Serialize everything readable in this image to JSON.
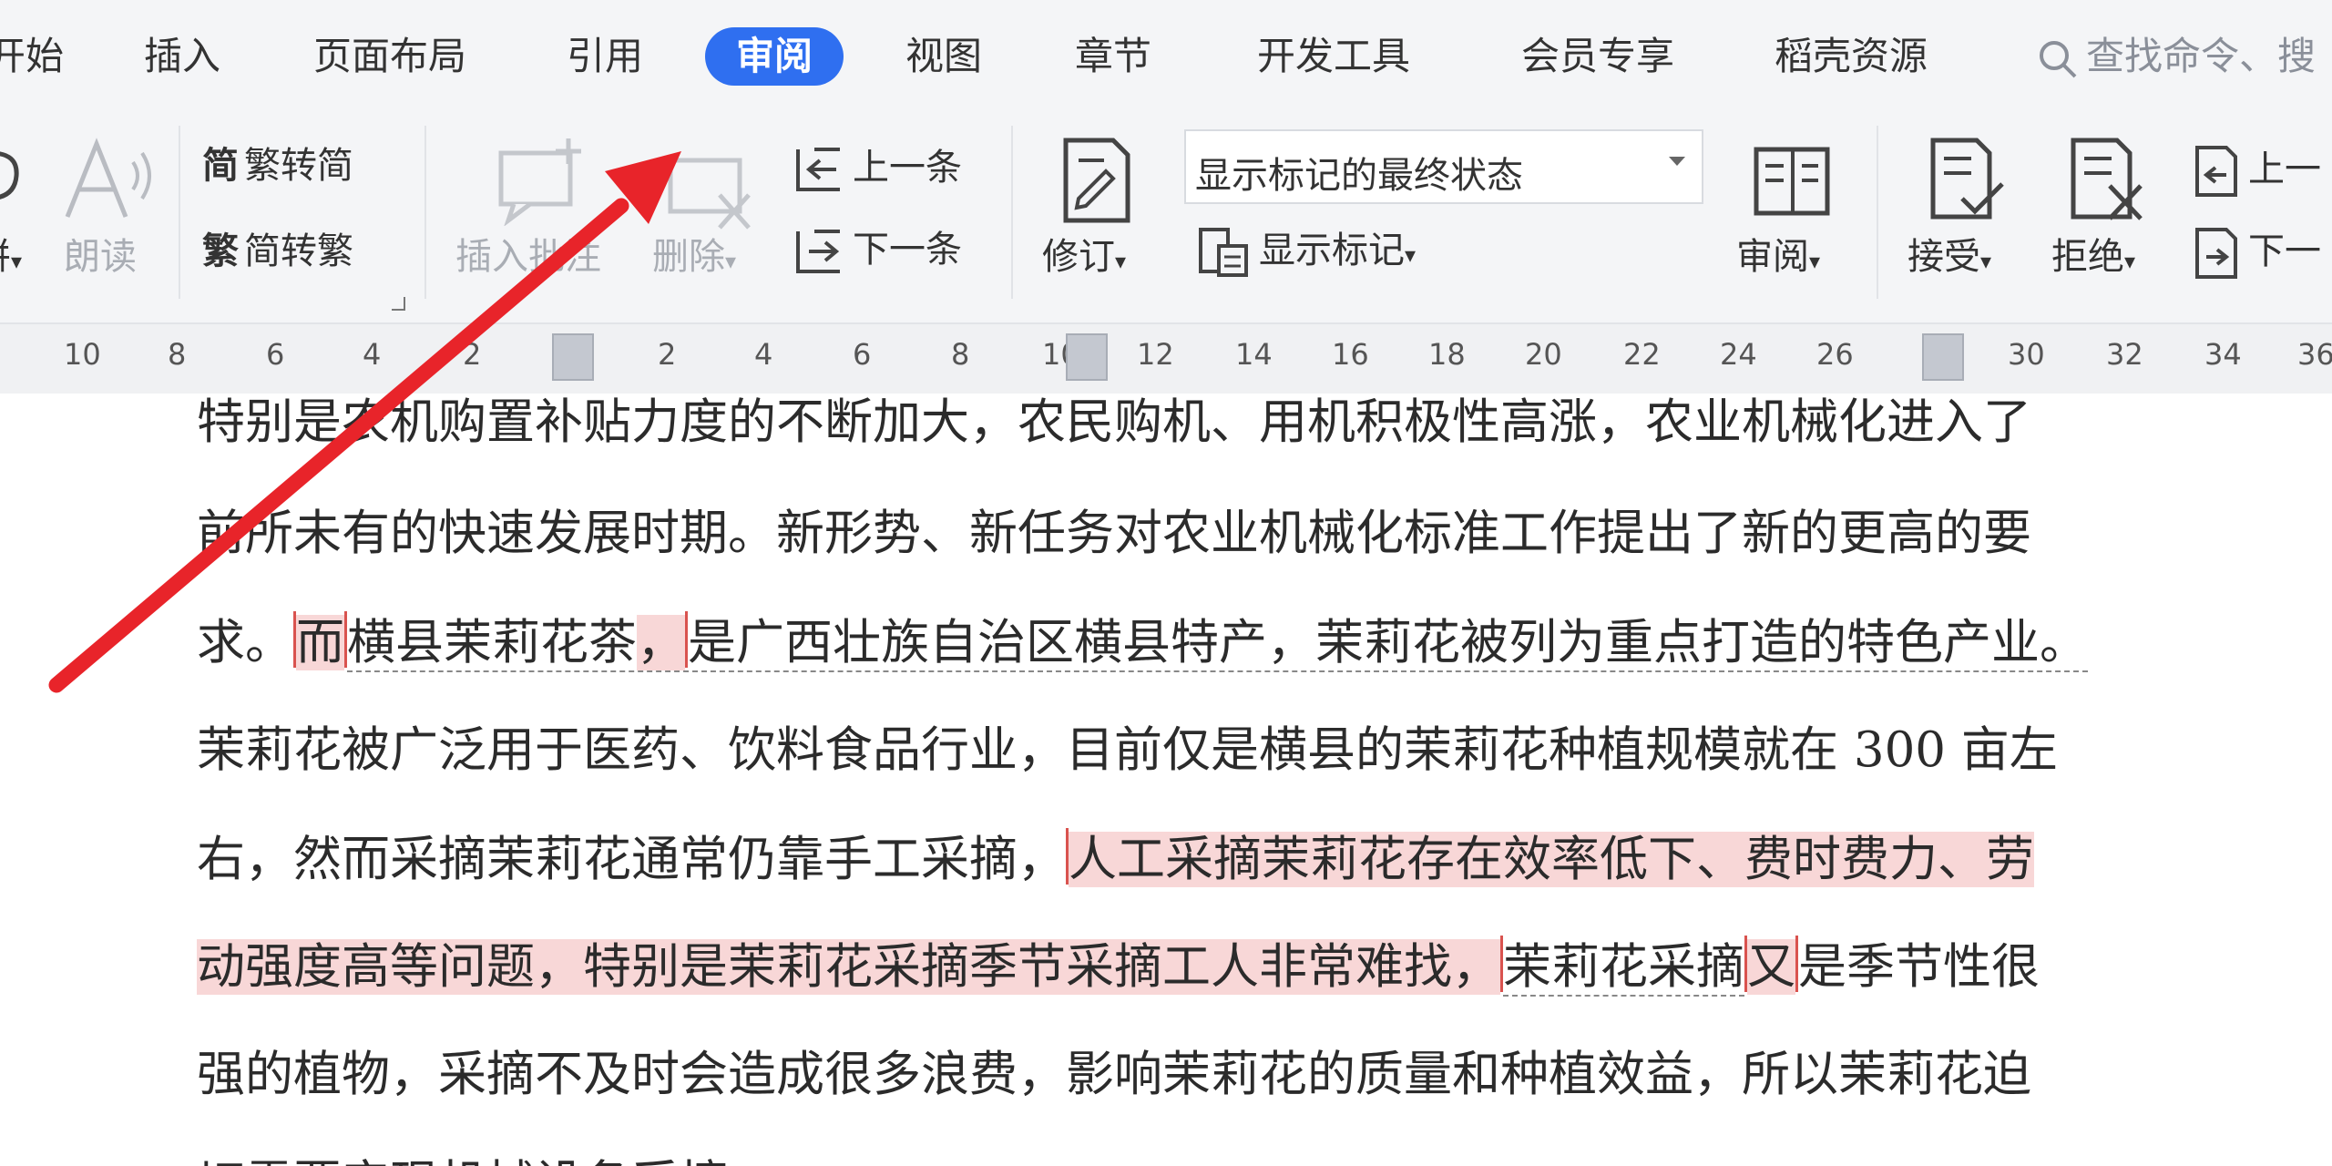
{
  "tabs": [
    "开始",
    "插入",
    "页面布局",
    "引用",
    "审阅",
    "视图",
    "章节",
    "开发工具",
    "会员专享",
    "稻壳资源"
  ],
  "active_tab": "审阅",
  "search": {
    "placeholder": "查找命令、搜"
  },
  "ribbon": {
    "spell_label": "拼",
    "read_label": "朗读",
    "to_simplified": "繁转简",
    "to_traditional": "简转繁",
    "insert_comment": "插入批注",
    "delete_label": "删除",
    "prev_comment": "上一条",
    "next_comment": "下一条",
    "track_changes": "修订",
    "markup_mode": "显示标记的最终状态",
    "show_markup": "显示标记",
    "review_pane": "审阅",
    "accept": "接受",
    "reject": "拒绝",
    "prev_change": "上一",
    "next_change": "下一"
  },
  "ruler": {
    "left": [
      "10",
      "8",
      "6",
      "4",
      "2"
    ],
    "right": [
      "2",
      "4",
      "6",
      "8",
      "10",
      "12",
      "14",
      "16",
      "18",
      "20",
      "22",
      "24",
      "26",
      "28",
      "30",
      "32",
      "34",
      "36"
    ]
  },
  "document": {
    "line1": "特别是农机购置补贴力度的不断加大，农民购机、用机积极性高涨，农业机械化进入了",
    "line2": "前所未有的快速发展时期。新形势、新任务对农业机械化标准工作提出了新的更高的要",
    "line3_a": "求。",
    "line3_del": "而",
    "line3_b": "横县茉莉花茶",
    "line3_del2": "，",
    "line3_c": "是广西壮族自治区横县特产，茉莉花被列为重点打造的特色产业。",
    "line4": "茉莉花被广泛用于医药、饮料食品行业，目前仅是横县的茉莉花种植规模就在 300 亩左",
    "line5_a": "右，然而采摘茉莉花通常仍靠手工采摘，",
    "line5_hl": "人工采摘茉莉花存在效率低下、费时费力、劳",
    "line6_hl": "动强度高等问题，特别是茉莉花采摘季节采摘工人非常难找，",
    "line6_b": "茉莉花采摘",
    "line6_del": "又",
    "line6_c": "是季节性很",
    "line7": "强的植物，采摘不及时会造成很多浪费，影响茉莉花的质量和种植效益，所以茉莉花迫",
    "line8": "切需要实现机械设备采摘。"
  },
  "colors": {
    "accent": "#2f6ff0",
    "revision_highlight": "#f8d7d7",
    "arrow": "#e8242a"
  }
}
